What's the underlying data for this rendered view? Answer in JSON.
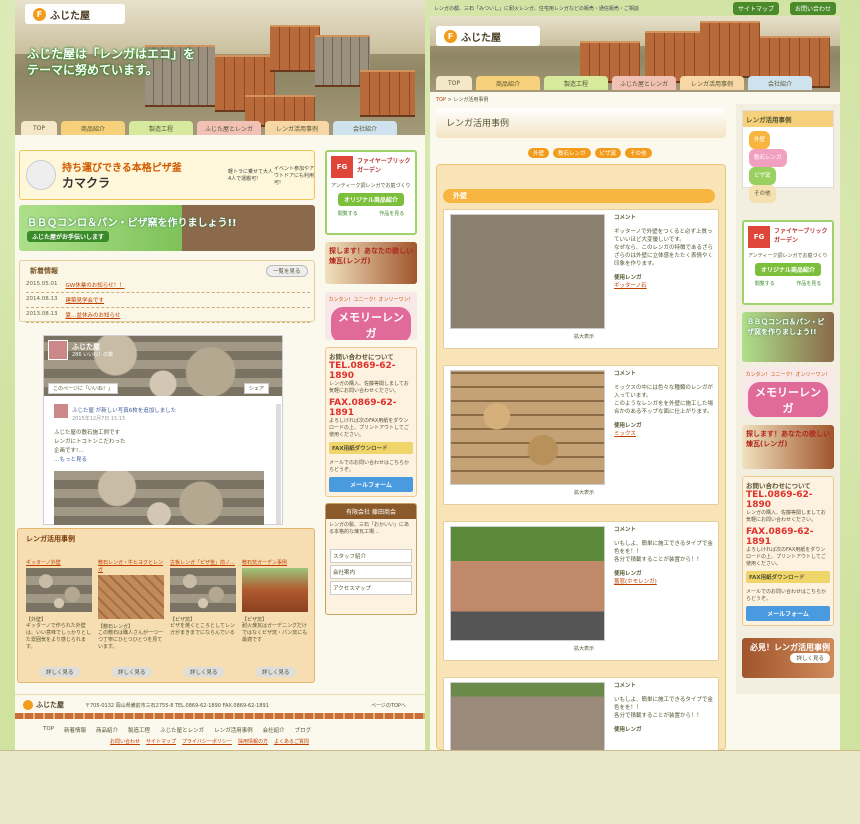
{
  "left": {
    "logo": "ふじた屋",
    "hero_lines": [
      "ふじた屋は「レンガはエコ」を",
      "テーマに努めています。"
    ],
    "nav": [
      "TOP",
      "商品紹介",
      "製造工程",
      "ふじた屋とレンガ",
      "レンガ活用事例",
      "会社紹介"
    ],
    "banner_pizza": {
      "title": "持ち運びできる本格ピザ釜",
      "sub": "カマクラ",
      "note1": "軽トラに乗せて大人4人で運搬可!",
      "note2": "イベント参加やアウトドアにも利用可!"
    },
    "banner_bbq": {
      "title": "ＢＢＱコンロ＆パン・ピザ窯を作りましょう!!",
      "sub": "ふじた屋がお手伝いします"
    },
    "news": {
      "title": "新着情報",
      "more": "一覧を見る",
      "items": [
        {
          "date": "2015.05.01",
          "text": "GW休業のお知らせ！！"
        },
        {
          "date": "2014.08.13",
          "text": "建築見学会です"
        },
        {
          "date": "2013.08.13",
          "text": "夏…盆休みのお知らせ"
        }
      ]
    },
    "fb": {
      "page": "ふじた屋",
      "likes": "286 いいね！の数",
      "like_btn": "このページに「いいね！」",
      "share": "シェア",
      "post_head": "ふじた屋 が新しい写真6枚を追加しました",
      "post_date": "2015年12月7日 15:15",
      "post_lines": [
        "ふじた屋の敷石施工例です",
        "レンガにトコトンこだわった",
        "企画です!…",
        "…もっと見る"
      ]
    },
    "case": {
      "title": "レンガ活用事例",
      "items": [
        {
          "link": "ギッターノ外壁",
          "head": "【外壁】",
          "text": "ギッターノで作られた外壁は、いい意味でしっかりとした雰囲気をより感じられます。",
          "btn": "詳しく見る"
        },
        {
          "link": "敷石レンガ・牛ヒヨクとレンガ",
          "head": "【敷石レンガ】",
          "text": "この敷石は職人さんが一つ一つ丁寧にひとつひとつを見ています。",
          "btn": "詳しく見る"
        },
        {
          "link": "古板レンガ「ピザ釜」前ノ…",
          "head": "【ピザ窯】",
          "text": "ピザを焼くところとしてレンガがまきまでにならんでいる",
          "btn": "詳しく見る"
        },
        {
          "link": "敷石窯ガーデン事例",
          "head": "【ピザ窯】",
          "text": "耐火煉瓦はガーデニングだけではなくピザ窯・パン窯にも最適です",
          "btn": "詳しく見る"
        }
      ]
    },
    "side": {
      "fb_title": "ファイヤーブリック ガーデン",
      "fb_sub": "アンティーク調レンガでお庭づくり",
      "fb_btn": "オリジナル商品紹介",
      "fb_l": "閲覧する",
      "fb_r": "作品を見る",
      "renga": "探します！あなたの欲しい煉瓦(レンガ)",
      "memory_top": "カンタン！ユニーク！オンリーワン！",
      "memory": "メモリーレンガ",
      "contact_title": "お問い合わせについて",
      "tel": "TEL.0869-62-1890",
      "tel_note": "レンガの購入、佐藤等関しましてお気軽にお問い合わせください。",
      "fax": "FAX.0869-62-1891",
      "fax_note": "よろしければ次のFAX用紙をダウンロードの上、プリントアウトしてご使用ください。",
      "fax_btn": "FAX用紙ダウンロード",
      "mail_note": "メールでのお問い合わせはこちらからどうぞ。",
      "mail_btn": "メールフォーム",
      "company": "有限会社 藤田商会",
      "company_text": "レンガの製、三石「おかいい」にある本格的な煉瓦工場…",
      "links": [
        "スタッフ紹介",
        "会社案内",
        "アクセスマップ"
      ]
    },
    "footer": {
      "logo": "ふじた屋",
      "addr": "〒705-0132 岡山県備前市三石2755-8 TEL.0869-62-1890 FAX.0869-62-1891",
      "top": "ページのTOPへ",
      "nav": [
        "TOP",
        "新着情報",
        "商品紹介",
        "製造工程",
        "ふじた屋とレンガ",
        "レンガ活用事例",
        "会社紹介",
        "ブログ"
      ],
      "links": [
        "お問い合わせ",
        "サイトマップ",
        "プライバシーポリシー",
        "採用情報の方",
        "よくあるご質問"
      ]
    }
  },
  "right": {
    "topline": "レンガの都、三石「みついし」に耐火レンガ、住宅用レンガなどの販売・通信販売・ご相談",
    "sitemap": "サイトマップ",
    "contact": "お問い合わせ",
    "logo": "ふじた屋",
    "nav": [
      "TOP",
      "商品紹介",
      "製造工程",
      "ふじた屋とレンガ",
      "レンガ活用事例",
      "会社紹介"
    ],
    "breadcrumb": [
      "TOP",
      "レンガ活用事例"
    ],
    "page_title": "レンガ活用事例",
    "tabs": [
      "外壁",
      "敷石レンガ",
      "ピザ窯",
      "その他"
    ],
    "section": "外壁",
    "cards": [
      {
        "label": "コメント",
        "text": "ギッターノで外壁をつくると必ず上質っていいほど大変優しいです。",
        "text2": "なぜなら、このレンガの特徴であるざらざらのは外壁に立体感をたたく表情やく印象を作ります。",
        "use": "使用レンガ",
        "link": "ギッターノ石",
        "zoom": "拡大表示"
      },
      {
        "label": "コメント",
        "text": "ミックスの中には色々な種類のレンガが入っています。",
        "text2": "このようなレンガをを外壁に施工した場合かのある不ップな面に仕上がります。",
        "use": "使用レンガ",
        "link": "ミックス",
        "zoom": "拡大表示"
      },
      {
        "label": "コメント",
        "text": "いもしよ、簡単に施工できるタイプで金色をを！！",
        "text2": "各分で積載することが装置から！！",
        "use": "使用レンガ",
        "link": "蓋窓(ホモレンガ)",
        "zoom": "拡大表示"
      },
      {
        "label": "コメント",
        "text": "いもしよ、簡単に施工できるタイプで金色をを！！",
        "text2": "各分で積載することが装置から！！",
        "use": "使用レンガ",
        "link": "",
        "zoom": ""
      }
    ],
    "side": {
      "title": "レンガ活用事例",
      "items": [
        "外壁",
        "敷石レンガ",
        "ピザ窯",
        "その他"
      ],
      "fb_title": "ファイヤーブリック ガーデン",
      "fb_sub": "アンティーク調レンガでお庭づくり",
      "fb_btn": "オリジナル商品紹介",
      "fb_l": "閲覧する",
      "fb_r": "作品を見る",
      "bbq": "ＢＢＱコンロ＆パン・ピザ窯を作りましょう!!",
      "memory_top": "カンタン！ユニーク！オンリーワン！",
      "memory": "メモリーレンガ",
      "renga": "探します！あなたの欲しい煉瓦(レンガ)",
      "contact_title": "お問い合わせについて",
      "tel": "TEL.0869-62-1890",
      "tel_note": "レンガの購入、佐藤等関しましてお気軽にお問い合わせください。",
      "fax": "FAX.0869-62-1891",
      "fax_note": "よろしければ次のFAX用紙をダウンロードの上、プリントアウトしてご使用ください。",
      "fax_btn": "FAX用紙ダウンロード",
      "mail_note": "メールでのお問い合わせはこちらからどうぞ。",
      "mail_btn": "メールフォーム",
      "case_banner": "必見！レンガ活用事例",
      "case_btn": "詳しく見る"
    }
  }
}
